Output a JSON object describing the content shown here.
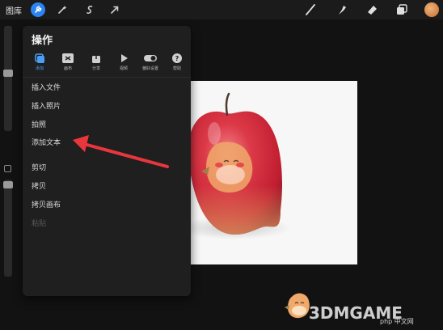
{
  "topbar": {
    "gallery_label": "图库",
    "tools": [
      "wrench-icon",
      "magic-wand-icon",
      "s-curve-icon",
      "arrow-cursor-icon",
      "brush-icon",
      "smudge-icon",
      "eraser-icon",
      "layers-icon"
    ],
    "accent": "#2c84f2"
  },
  "panel": {
    "title": "操作",
    "tabs": [
      {
        "label": "添加",
        "icon": "add-icon",
        "active": true
      },
      {
        "label": "画布",
        "icon": "canvas-icon",
        "active": false
      },
      {
        "label": "分享",
        "icon": "share-icon",
        "active": false
      },
      {
        "label": "视频",
        "icon": "video-icon",
        "active": false
      },
      {
        "label": "偏好设置",
        "icon": "toggle-icon",
        "active": false
      },
      {
        "label": "帮助",
        "icon": "help-icon",
        "active": false
      }
    ],
    "items": [
      {
        "label": "插入文件",
        "enabled": true
      },
      {
        "label": "插入照片",
        "enabled": true
      },
      {
        "label": "拍照",
        "enabled": true
      },
      {
        "label": "添加文本",
        "enabled": true
      },
      {
        "label": "剪切",
        "enabled": true
      },
      {
        "label": "拷贝",
        "enabled": true
      },
      {
        "label": "拷贝画布",
        "enabled": true
      },
      {
        "label": "粘贴",
        "enabled": false
      }
    ]
  },
  "watermark": {
    "brand": "3DMGAME",
    "php": "php 中文网"
  },
  "colors": {
    "annotation_arrow": "#e8363d",
    "apple_red": "#d9283a"
  }
}
